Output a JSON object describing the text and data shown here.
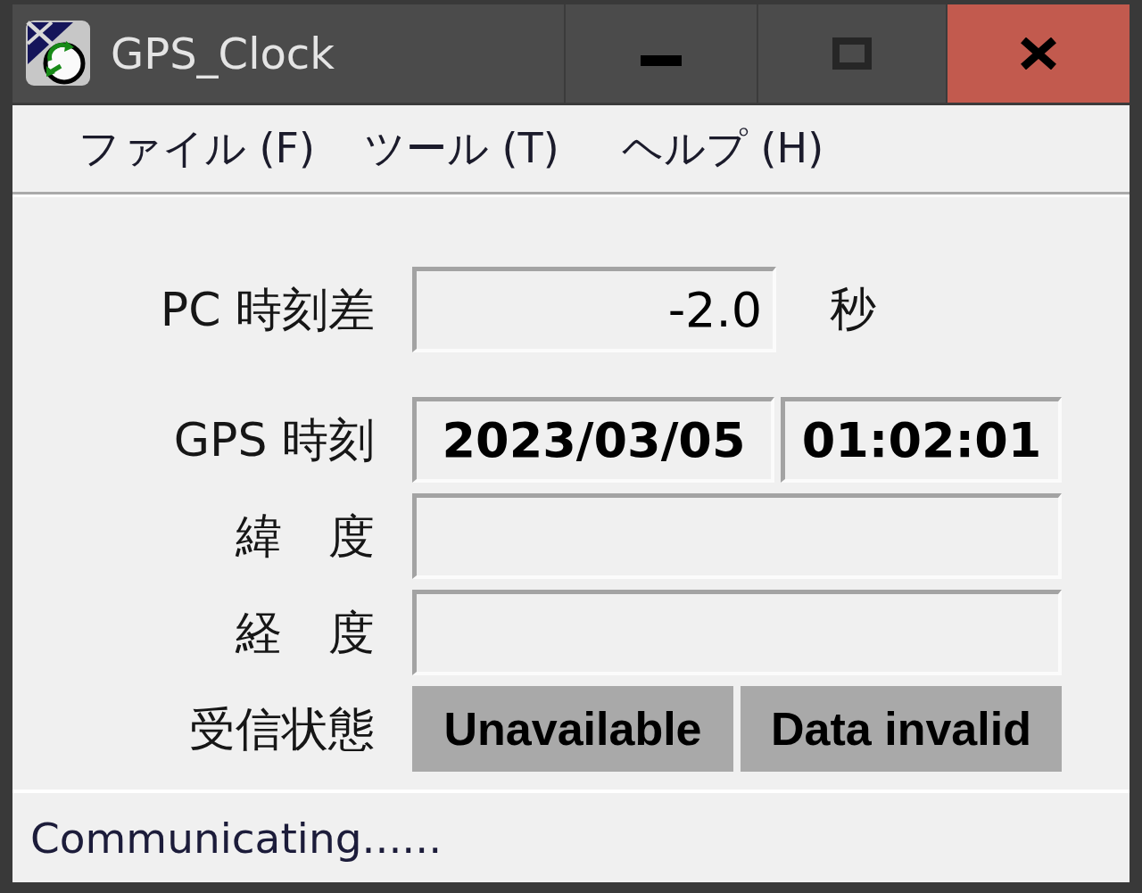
{
  "window": {
    "title": "GPS_Clock"
  },
  "menu": [
    "ファイル (F)",
    "ツール (T)",
    "ヘルプ (H)"
  ],
  "form": {
    "rows": [
      {
        "kind": "number",
        "label": "PC 時刻差",
        "value": "-2.0",
        "unit": "秒"
      },
      {
        "kind": "date_time",
        "label": "GPS 時刻",
        "date": "2023/03/05",
        "time": "01:02:01"
      },
      {
        "kind": "text",
        "label": "緯　度"
      },
      {
        "kind": "text",
        "label": "経　度"
      },
      {
        "kind": "indicators",
        "label": "受信状態",
        "indicators": [
          "Unavailable",
          "Data invalid"
        ]
      }
    ]
  },
  "status_bar": {
    "text": "Communicating......"
  }
}
